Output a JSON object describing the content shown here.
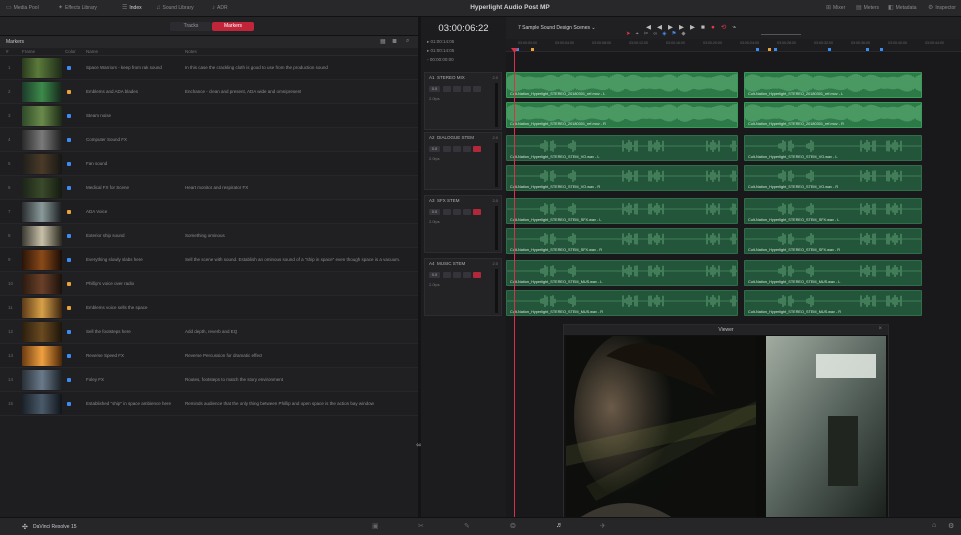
{
  "topbar": {
    "items": [
      {
        "label": "Media Pool",
        "icon": "media-pool-icon"
      },
      {
        "label": "Effects Library",
        "icon": "effects-icon"
      },
      {
        "label": "Index",
        "icon": "index-icon"
      },
      {
        "label": "Sound Library",
        "icon": "sound-library-icon"
      },
      {
        "label": "ADR",
        "icon": "adr-icon"
      }
    ],
    "title": "Hyperlight Audio Post MP",
    "right_items": [
      {
        "label": "Mixer",
        "icon": "mixer-icon"
      },
      {
        "label": "Meters",
        "icon": "meters-icon"
      },
      {
        "label": "Metadata",
        "icon": "metadata-icon"
      },
      {
        "label": "Inspector",
        "icon": "inspector-icon"
      }
    ]
  },
  "index": {
    "tabs": [
      "Tracks",
      "Markers"
    ],
    "active_tab": "Markers",
    "section_title": "Markers",
    "columns": [
      "#",
      "Frame",
      "Color",
      "Name",
      "Notes"
    ],
    "rows": [
      {
        "idx": "1",
        "color": "#3d8df0",
        "name": "Space Warriors - keep from rak sound",
        "note": "In this case the crackling cloth is good to use from the production sound",
        "thumb": "linear-gradient(90deg,#2a3a1e,#5b7a3a 40%,#1e2a18)"
      },
      {
        "idx": "2",
        "color": "#e8a33a",
        "name": "Emblems and ADA blades",
        "note": "Enchance - clean and present, ADA wide and omnipresent",
        "thumb": "linear-gradient(90deg,#1d3a2a,#3c8a4a 50%,#15261a)"
      },
      {
        "idx": "3",
        "color": "#3d8df0",
        "name": "Steam noise",
        "note": "",
        "thumb": "linear-gradient(90deg,#2e4a2a,#6a8a4a 50%,#1c2a16)"
      },
      {
        "idx": "4",
        "color": "#3d8df0",
        "name": "Computer Sound FX",
        "note": "",
        "thumb": "linear-gradient(90deg,#2a2a2a,#7a7a7a 50%,#202020)"
      },
      {
        "idx": "5",
        "color": "#3d8df0",
        "name": "Fan sound",
        "note": "",
        "thumb": "linear-gradient(90deg,#1e1e1c,#4a3a28 50%,#161614)"
      },
      {
        "idx": "6",
        "color": "#3d8df0",
        "name": "Medical FX for Scene",
        "note": "Heart monitor and respirator FX",
        "thumb": "linear-gradient(90deg,#1c2418,#3a4a2a 50%,#141a10)"
      },
      {
        "idx": "7",
        "color": "#e8a33a",
        "name": "ADA Voice",
        "note": "",
        "thumb": "linear-gradient(90deg,#2a2e30,#8a9a9a 50%,#1a1c1e)"
      },
      {
        "idx": "8",
        "color": "#3d8df0",
        "name": "Exterior ship sound",
        "note": "Something ominous",
        "thumb": "linear-gradient(90deg,#3a3a32,#c8c0a8 50%,#2a2820)"
      },
      {
        "idx": "9",
        "color": "#3d8df0",
        "name": "Everything slowly slabs here",
        "note": "Sell the scene with sound. Establish an ominous sound of a \"ship in space\" even though space is a vacuum.",
        "thumb": "linear-gradient(90deg,#2a1408,#8a4a18 50%,#1a0c06)"
      },
      {
        "idx": "10",
        "color": "#e8a33a",
        "name": "Phillip's voice over radio",
        "note": "",
        "thumb": "linear-gradient(90deg,#2a1a10,#6a4028 50%,#1a100a)"
      },
      {
        "idx": "11",
        "color": "#e8a33a",
        "name": "Emblems voice sells the space",
        "note": "",
        "thumb": "linear-gradient(90deg,#5a3a18,#d8a048 50%,#3a2410)"
      },
      {
        "idx": "12",
        "color": "#3d8df0",
        "name": "Sell the footsteps here",
        "note": "Add depth, reverb and EQ",
        "thumb": "linear-gradient(90deg,#2a1e0e,#6a4a20 50%,#1c140a)"
      },
      {
        "idx": "13",
        "color": "#3d8df0",
        "name": "Reverse Speed FX",
        "note": "Reverse Percussion for dramatic effect",
        "thumb": "linear-gradient(90deg,#6a3a10,#f0a040 50%,#4a2608)"
      },
      {
        "idx": "14",
        "color": "#3d8df0",
        "name": "Foley FX",
        "note": "Routes, footsteps to match the story environment",
        "thumb": "linear-gradient(90deg,#2a3038,#6a7a8a 50%,#1a2026)"
      },
      {
        "idx": "15",
        "color": "#3d8df0",
        "name": "Established \"ship\" in space ambience here",
        "note": "Reminds audience that the only thing between Phillip and open space is the action bay window",
        "thumb": "linear-gradient(90deg,#1a2028,#4a5a6a 50%,#10141a)"
      }
    ]
  },
  "timecode": {
    "main": "03:00:06:22",
    "lines": [
      "01:00:14:05",
      "01:00:14:05",
      "00:00:00:00"
    ],
    "line_icons": [
      "in-point-icon",
      "out-point-icon",
      "duration-icon"
    ]
  },
  "timeline": {
    "name": "7 Sample Sound Design Scenes",
    "ruler": [
      "03:00:00:00",
      "03:00:04:00",
      "03:00:08:00",
      "03:00:12:00",
      "03:00:16:00",
      "03:00:20:00",
      "03:00:24:00",
      "03:00:28:00",
      "03:00:32:00",
      "03:00:36:00",
      "03:00:40:00",
      "03:00:44:00"
    ],
    "tracks": [
      {
        "id": "A1",
        "name": "STEREO MIX",
        "ch": "2.0",
        "vol": "0.0",
        "fmt": "2.0ips"
      },
      {
        "id": "A2",
        "name": "DIALOGUE STEM",
        "ch": "2.0",
        "vol": "0.0",
        "fmt": "2.0ips"
      },
      {
        "id": "A3",
        "name": "SFX STEM",
        "ch": "2.0",
        "vol": "0.0",
        "fmt": "2.0ips"
      },
      {
        "id": "A4",
        "name": "MUSIC STEM",
        "ch": "2.0",
        "vol": "0.0",
        "fmt": "2.0ips"
      }
    ],
    "clips": [
      {
        "label": "Cult-Nation_Hyperlight_STEREO_20180301_ref.mov - L",
        "label2": "Cult-Nation_Hyperlight_STEREO_20180301_ref.mov - L",
        "color": "#3a9a5a",
        "bg": "#2d7a48"
      },
      {
        "label": "Cult-Nation_Hyperlight_STEREO_20180301_ref.mov - R",
        "label2": "Cult-Nation_Hyperlight_STEREO_20180301_ref.mov - R",
        "color": "#3a9a5a",
        "bg": "#2d7a48"
      },
      {
        "label": "Cult-Nation_Hyperlight_STEREO_STEM_VO.wav - L",
        "label2": "Cult-Nation_Hyperlight_STEREO_STEM_VO.wav - L",
        "color": "#2f6e48",
        "bg": "#23553a"
      },
      {
        "label": "Cult-Nation_Hyperlight_STEREO_STEM_VO.wav - R",
        "label2": "Cult-Nation_Hyperlight_STEREO_STEM_VO.wav - R",
        "color": "#2f6e48",
        "bg": "#23553a"
      },
      {
        "label": "Cult-Nation_Hyperlight_STEREO_STEM_SFX.wav - L",
        "label2": "Cult-Nation_Hyperlight_STEREO_STEM_SFX.wav - L",
        "color": "#2f6e48",
        "bg": "#23553a"
      },
      {
        "label": "Cult-Nation_Hyperlight_STEREO_STEM_SFX.wav - R",
        "label2": "Cult-Nation_Hyperlight_STEREO_STEM_SFX.wav - R",
        "color": "#2f6e48",
        "bg": "#23553a"
      },
      {
        "label": "Cult-Nation_Hyperlight_STEREO_STEM_MUS.wav - L",
        "label2": "Cult-Nation_Hyperlight_STEREO_STEM_MUS.wav - L",
        "color": "#2f6e48",
        "bg": "#23553a"
      },
      {
        "label": "Cult-Nation_Hyperlight_STEREO_STEM_MUS.wav - R",
        "label2": "Cult-Nation_Hyperlight_STEREO_STEM_MUS.wav - R",
        "color": "#2f6e48",
        "bg": "#23553a"
      }
    ]
  },
  "viewer": {
    "title": "Viewer"
  },
  "bottom": {
    "app_name": "DaVinci Resolve 15",
    "pages": [
      "media-icon",
      "cut-icon",
      "edit-icon",
      "fusion-icon",
      "color-icon",
      "fairlight-icon",
      "deliver-icon"
    ],
    "active_page": "fairlight-icon"
  },
  "colors": {
    "accent": "#e0374a",
    "marker_blue": "#3d8df0",
    "marker_orange": "#e8a33a",
    "clip_green": "#3a9a5a"
  }
}
